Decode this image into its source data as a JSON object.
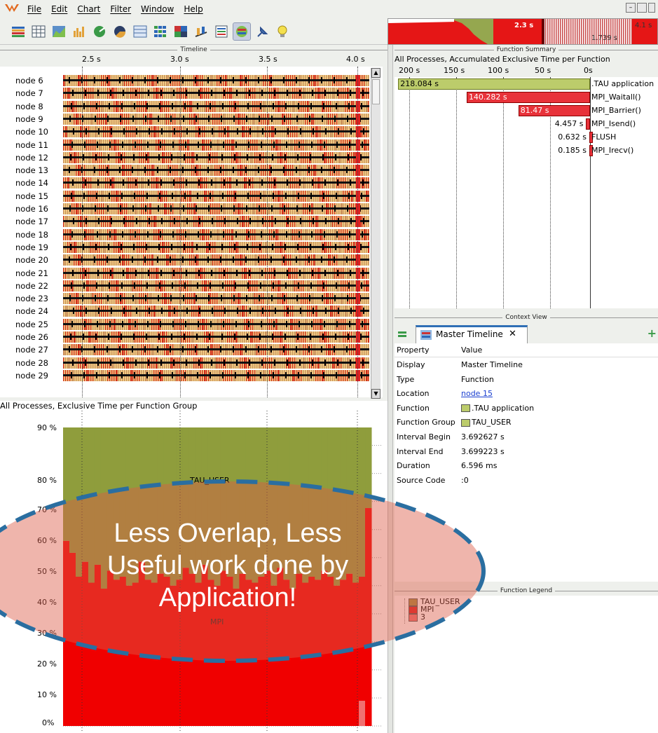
{
  "menu": [
    "File",
    "Edit",
    "Chart",
    "Filter",
    "Window",
    "Help"
  ],
  "toolbar_icons": [
    "stacked-bars-icon",
    "grid-chart-icon",
    "area-chart-icon",
    "histogram-icon",
    "radar-icon",
    "pie-chart-icon",
    "table-icon",
    "heatmap-icon",
    "color-matrix-icon",
    "3d-bars-icon",
    "list-icon",
    "timeline-icon",
    "pin-icon",
    "lightbulb-icon"
  ],
  "minimap": {
    "label_a": "2.3 s",
    "label_b": "1.739 s",
    "label_c": "4.1 s"
  },
  "timeline": {
    "frame_title": "Timeline",
    "ticks": [
      "2.5 s",
      "3.0 s",
      "3.5 s",
      "4.0 s"
    ],
    "nodes": [
      "node 6",
      "node 7",
      "node 8",
      "node 9",
      "node 10",
      "node 11",
      "node 12",
      "node 13",
      "node 14",
      "node 15",
      "node 16",
      "node 17",
      "node 18",
      "node 19",
      "node 20",
      "node 21",
      "node 22",
      "node 23",
      "node 24",
      "node 25",
      "node 26",
      "node 27",
      "node 28",
      "node 29"
    ]
  },
  "group_chart": {
    "title": "All Processes, Exclusive Time per Function Group",
    "y_ticks": [
      "90 %",
      "80 %",
      "70 %",
      "60 %",
      "50 %",
      "40 %",
      "30 %",
      "20 %",
      "10 %",
      "0%"
    ],
    "label_tau": "TAU_USER",
    "label_mpi": "MPI"
  },
  "chart_data": {
    "type": "area",
    "title": "All Processes, Exclusive Time per Function Group",
    "ylabel": "",
    "ylim": [
      0,
      100
    ],
    "series": [
      {
        "name": "MPI",
        "values": [
          62,
          58,
          50,
          55,
          48,
          54,
          46,
          52,
          49,
          50,
          47,
          48,
          55,
          49,
          48,
          51,
          50,
          47,
          49,
          53,
          51,
          48,
          54,
          49,
          47,
          52,
          50,
          46,
          51,
          49,
          48,
          50,
          52,
          47,
          53,
          49,
          46,
          51,
          48,
          50,
          49,
          52,
          50,
          47,
          49,
          51,
          48,
          50,
          73
        ]
      },
      {
        "name": "TAU_USER",
        "values": [
          38,
          42,
          50,
          45,
          52,
          46,
          54,
          48,
          51,
          50,
          53,
          52,
          45,
          51,
          52,
          49,
          50,
          53,
          51,
          47,
          49,
          52,
          46,
          51,
          53,
          48,
          50,
          54,
          49,
          51,
          52,
          50,
          48,
          53,
          47,
          51,
          54,
          49,
          52,
          50,
          51,
          48,
          50,
          53,
          51,
          49,
          52,
          50,
          27
        ]
      }
    ]
  },
  "function_summary": {
    "frame_title": "Function Summary",
    "title": "All Processes, Accumulated Exclusive Time per Function",
    "axis_ticks": [
      "200 s",
      "150 s",
      "100 s",
      "50 s",
      "0s"
    ],
    "rows": [
      {
        "name": ".TAU application",
        "value": "218.084 s",
        "seconds": 218.084,
        "color": "#bccc6b"
      },
      {
        "name": "MPI_Waitall()",
        "value": "140.282 s",
        "seconds": 140.282,
        "color": "#e8323a"
      },
      {
        "name": "MPI_Barrier()",
        "value": "81.47 s",
        "seconds": 81.47,
        "color": "#e8323a"
      },
      {
        "name": "MPI_Isend()",
        "value": "4.457 s",
        "seconds": 4.457,
        "color": "#e8323a"
      },
      {
        "name": "FLUSH",
        "value": "0.632 s",
        "seconds": 0.632,
        "color": "#e8323a"
      },
      {
        "name": "MPI_Irecv()",
        "value": "0.185 s",
        "seconds": 0.185,
        "color": "#e8323a"
      }
    ]
  },
  "context_view": {
    "frame_title": "Context View",
    "tab_label": "Master Timeline",
    "header_property": "Property",
    "header_value": "Value",
    "rows": [
      {
        "k": "Display",
        "v": "Master Timeline"
      },
      {
        "k": "Type",
        "v": "Function"
      },
      {
        "k": "Location",
        "v": "node 15"
      },
      {
        "k": "Function",
        "v": ".TAU application"
      },
      {
        "k": "Function Group",
        "v": "TAU_USER"
      },
      {
        "k": "Interval Begin",
        "v": "3.692627 s"
      },
      {
        "k": "Interval End",
        "v": "3.699223 s"
      },
      {
        "k": "Duration",
        "v": "6.596 ms"
      },
      {
        "k": "Source Code",
        "v": ":0"
      }
    ]
  },
  "legend": {
    "frame_title": "Function Legend",
    "items": [
      {
        "label": "TAU_USER",
        "color": "#a68c3e"
      },
      {
        "label": "MPI",
        "color": "#e02020"
      },
      {
        "label": "3",
        "color": "#f07070"
      }
    ]
  },
  "annotation": {
    "text_line1": "Less Overlap, Less",
    "text_line2": "Useful work done by",
    "text_line3": "Application!"
  },
  "colors": {
    "tau": "#8f9d3c",
    "mpi": "#f00000",
    "overlay": "rgba(220,80,60,0.45)",
    "dash": "#2a6ea0"
  }
}
